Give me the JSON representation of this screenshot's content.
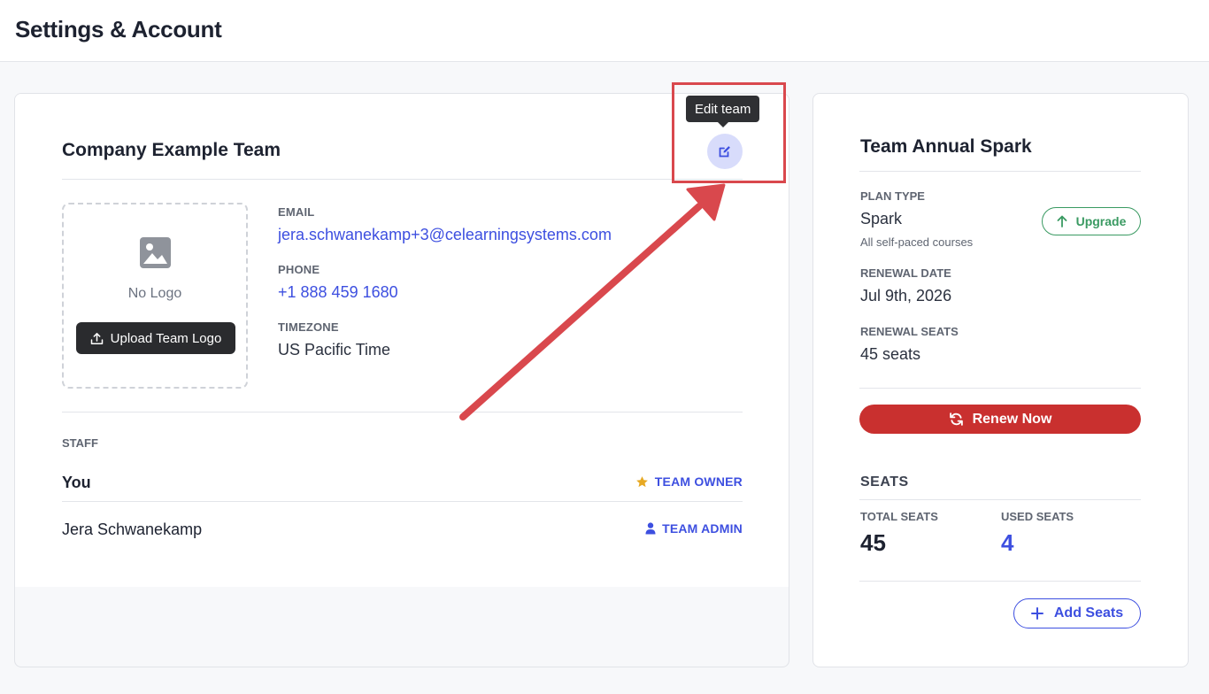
{
  "header": {
    "title": "Settings & Account"
  },
  "team": {
    "name": "Company Example Team",
    "edit_tooltip": "Edit team",
    "logo": {
      "empty_text": "No Logo",
      "upload_label": "Upload Team Logo"
    },
    "email": {
      "label": "EMAIL",
      "value": "jera.schwanekamp+3@celearningsystems.com"
    },
    "phone": {
      "label": "PHONE",
      "value": "+1 888 459 1680"
    },
    "timezone": {
      "label": "TIMEZONE",
      "value": "US Pacific Time"
    },
    "staff": {
      "label": "STAFF",
      "members": [
        {
          "name": "You",
          "role": "TEAM OWNER",
          "role_icon": "star-icon"
        },
        {
          "name": "Jera Schwanekamp",
          "role": "TEAM ADMIN",
          "role_icon": "person-icon"
        }
      ]
    }
  },
  "plan": {
    "title": "Team Annual Spark",
    "plan_type": {
      "label": "PLAN TYPE",
      "value": "Spark",
      "note": "All self-paced courses"
    },
    "upgrade_label": "Upgrade",
    "renewal_date": {
      "label": "RENEWAL DATE",
      "value": "Jul 9th, 2026"
    },
    "renewal_seats": {
      "label": "RENEWAL SEATS",
      "value": "45 seats"
    },
    "renew_label": "Renew Now",
    "seats": {
      "heading": "SEATS",
      "total_label": "TOTAL SEATS",
      "total_value": "45",
      "used_label": "USED SEATS",
      "used_value": "4",
      "add_label": "Add Seats"
    }
  },
  "colors": {
    "accent": "#3d4fe0",
    "renew": "#c9302f",
    "upgrade": "#3a9a62",
    "annotation": "#d9484d",
    "star": "#e7a923"
  }
}
